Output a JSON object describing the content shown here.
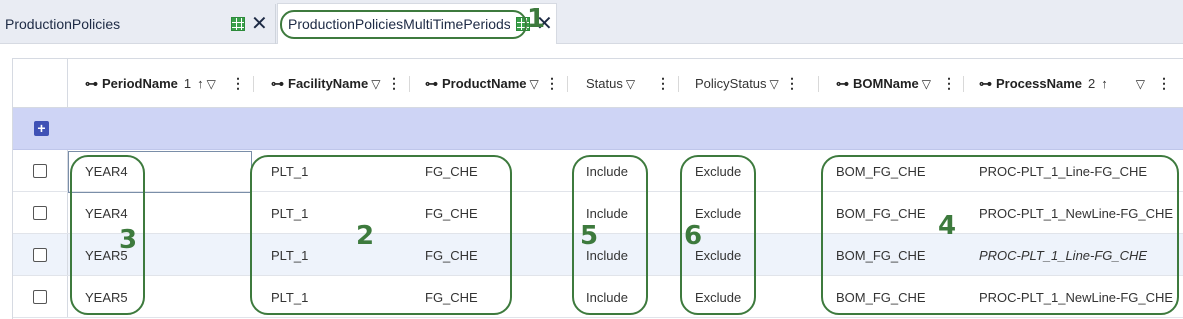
{
  "tabs": [
    {
      "label": "ProductionPolicies"
    },
    {
      "label": "ProductionPoliciesMultiTimePeriods"
    }
  ],
  "columns": {
    "period": {
      "label": "PeriodName",
      "sort_index": "1",
      "sort": "↑"
    },
    "facility": {
      "label": "FacilityName"
    },
    "product": {
      "label": "ProductName"
    },
    "status": {
      "label": "Status"
    },
    "policy": {
      "label": "PolicyStatus"
    },
    "bom": {
      "label": "BOMName"
    },
    "process": {
      "label": "ProcessName",
      "sort_index": "2",
      "sort": "↑"
    }
  },
  "icons": {
    "filter": "▽",
    "dots": "⋮",
    "key": "⊶",
    "close": "✕",
    "plus": "+"
  },
  "rows": [
    {
      "period": "YEAR4",
      "facility": "PLT_1",
      "product": "FG_CHE",
      "status": "Include",
      "policy": "Exclude",
      "bom": "BOM_FG_CHE",
      "process": "PROC-PLT_1_Line-FG_CHE"
    },
    {
      "period": "YEAR4",
      "facility": "PLT_1",
      "product": "FG_CHE",
      "status": "Include",
      "policy": "Exclude",
      "bom": "BOM_FG_CHE",
      "process": "PROC-PLT_1_NewLine-FG_CHE"
    },
    {
      "period": "YEAR5",
      "facility": "PLT_1",
      "product": "FG_CHE",
      "status": "Include",
      "policy": "Exclude",
      "bom": "BOM_FG_CHE",
      "process": "PROC-PLT_1_Line-FG_CHE"
    },
    {
      "period": "YEAR5",
      "facility": "PLT_1",
      "product": "FG_CHE",
      "status": "Include",
      "policy": "Exclude",
      "bom": "BOM_FG_CHE",
      "process": "PROC-PLT_1_NewLine-FG_CHE"
    }
  ],
  "annotations": [
    "1",
    "2",
    "3",
    "4",
    "5",
    "6"
  ],
  "colors": {
    "annotation": "#3d7a3d",
    "add_row": "#ced4f5",
    "accent": "#3f51b5"
  }
}
